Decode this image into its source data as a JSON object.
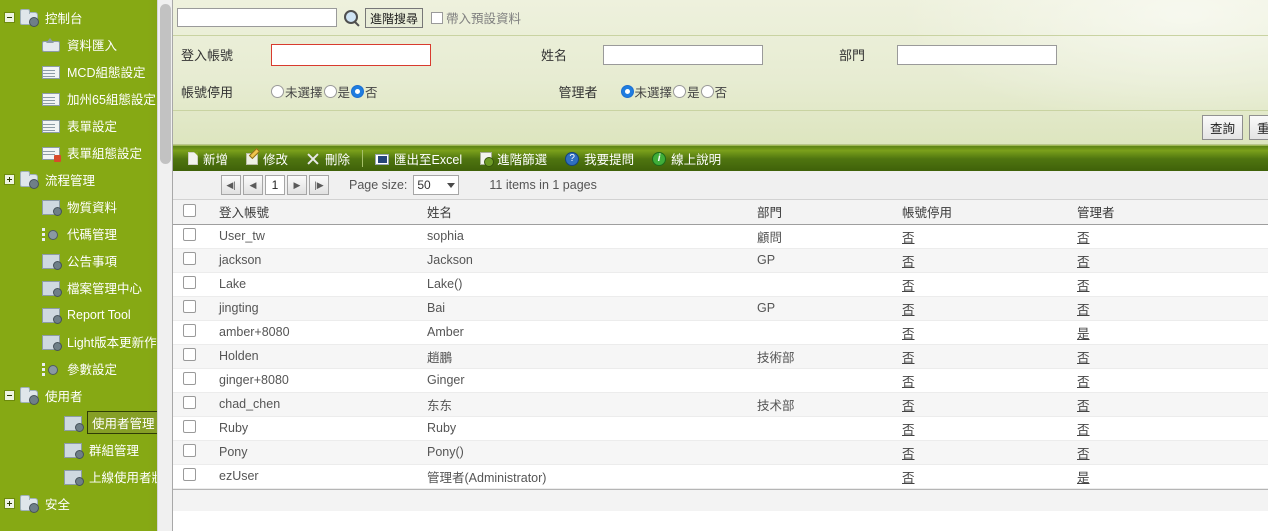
{
  "sidebar": {
    "items": [
      {
        "label": "控制台",
        "level": 0,
        "icon": "folder-icon",
        "expander": "minus",
        "selected": false
      },
      {
        "label": "資料匯入",
        "level": 1,
        "icon": "import-icon",
        "expander": "none",
        "selected": false
      },
      {
        "label": "MCD組態設定",
        "level": 1,
        "icon": "grid-icon",
        "expander": "none",
        "selected": false
      },
      {
        "label": "加州65組態設定",
        "level": 1,
        "icon": "grid-icon",
        "expander": "none",
        "selected": false
      },
      {
        "label": "表單設定",
        "level": 1,
        "icon": "grid-icon",
        "expander": "none",
        "selected": false
      },
      {
        "label": "表單組態設定",
        "level": 1,
        "icon": "grid-warning-icon",
        "expander": "none",
        "selected": false
      },
      {
        "label": "流程管理",
        "level": 0,
        "icon": "folder-icon",
        "expander": "plus",
        "selected": false
      },
      {
        "label": "物質資料",
        "level": 1,
        "icon": "page-icon",
        "expander": "none",
        "selected": false
      },
      {
        "label": "代碼管理",
        "level": 1,
        "icon": "dots-icon",
        "expander": "none",
        "selected": false
      },
      {
        "label": "公告事項",
        "level": 1,
        "icon": "page-icon",
        "expander": "none",
        "selected": false
      },
      {
        "label": "檔案管理中心",
        "level": 1,
        "icon": "page-icon",
        "expander": "none",
        "selected": false
      },
      {
        "label": "Report Tool",
        "level": 1,
        "icon": "page-icon",
        "expander": "none",
        "selected": false
      },
      {
        "label": "Light版本更新作業",
        "level": 1,
        "icon": "page-icon",
        "expander": "none",
        "selected": false
      },
      {
        "label": "參數設定",
        "level": 1,
        "icon": "dots-icon",
        "expander": "none",
        "selected": false
      },
      {
        "label": "使用者",
        "level": 0,
        "icon": "folder-icon",
        "expander": "minus",
        "selected": false
      },
      {
        "label": "使用者管理",
        "level": 2,
        "icon": "page-icon",
        "expander": "none",
        "selected": true
      },
      {
        "label": "群組管理",
        "level": 2,
        "icon": "page-icon",
        "expander": "none",
        "selected": false
      },
      {
        "label": "上線使用者狀態",
        "level": 2,
        "icon": "page-icon",
        "expander": "none",
        "selected": false
      },
      {
        "label": "安全",
        "level": 0,
        "icon": "folder-icon",
        "expander": "plus",
        "selected": false
      }
    ]
  },
  "search": {
    "quick_value": "",
    "search_icon": "magnifier-icon",
    "advanced_button": "進階搜尋",
    "default_data_checkbox_label": "帶入預設資料",
    "default_data_checked": false,
    "fields": {
      "login_account_label": "登入帳號",
      "login_account_value": "",
      "name_label": "姓名",
      "name_value": "",
      "dept_label": "部門",
      "dept_value": "",
      "account_disabled_label": "帳號停用",
      "account_disabled_options": [
        "未選擇",
        "是",
        "否"
      ],
      "account_disabled_selected": "否",
      "admin_label": "管理者",
      "admin_options": [
        "未選擇",
        "是",
        "否"
      ],
      "admin_selected": "未選擇"
    },
    "query_button": "查詢",
    "reset_button": "重設"
  },
  "toolbar": {
    "items": [
      {
        "label": "新增",
        "icon": "new-page-icon"
      },
      {
        "label": "修改",
        "icon": "edit-pencil-icon"
      },
      {
        "label": "刪除",
        "icon": "delete-x-icon"
      },
      {
        "label": "匯出至Excel",
        "icon": "excel-export-icon"
      },
      {
        "label": "進階篩選",
        "icon": "advanced-filter-icon"
      },
      {
        "label": "我要提問",
        "icon": "question-mark-icon",
        "glyph": "?"
      },
      {
        "label": "線上說明",
        "icon": "info-icon",
        "glyph": "i"
      }
    ]
  },
  "pager": {
    "first_icon": "first-page-icon",
    "prev_icon": "prev-page-icon",
    "next_icon": "next-page-icon",
    "last_icon": "last-page-icon",
    "current_page": "1",
    "page_size_label": "Page size:",
    "page_size_value": "50",
    "item_count_text": "11 items in 1 pages"
  },
  "grid": {
    "columns": [
      "登入帳號",
      "姓名",
      "部門",
      "帳號停用",
      "管理者"
    ],
    "select_all_checked": false,
    "rows": [
      {
        "account": "User_tw",
        "name": "sophia",
        "dept": "顧問",
        "disabled": "否",
        "admin": "否"
      },
      {
        "account": "jackson",
        "name": "Jackson",
        "dept": "GP",
        "disabled": "否",
        "admin": "否"
      },
      {
        "account": "Lake",
        "name": "Lake()",
        "dept": "",
        "disabled": "否",
        "admin": "否"
      },
      {
        "account": "jingting",
        "name": "Bai",
        "dept": "GP",
        "disabled": "否",
        "admin": "否"
      },
      {
        "account": "amber+8080",
        "name": "Amber",
        "dept": "",
        "disabled": "否",
        "admin": "是"
      },
      {
        "account": "Holden",
        "name": "趙鵬",
        "dept": "技術部",
        "disabled": "否",
        "admin": "否"
      },
      {
        "account": "ginger+8080",
        "name": "Ginger",
        "dept": "",
        "disabled": "否",
        "admin": "否"
      },
      {
        "account": "chad_chen",
        "name": "东东",
        "dept": "技术部",
        "disabled": "否",
        "admin": "否"
      },
      {
        "account": "Ruby",
        "name": "Ruby",
        "dept": "",
        "disabled": "否",
        "admin": "否"
      },
      {
        "account": "Pony",
        "name": "Pony()",
        "dept": "",
        "disabled": "否",
        "admin": "否"
      },
      {
        "account": "ezUser",
        "name": "管理者(Administrator)",
        "dept": "",
        "disabled": "否",
        "admin": "是"
      }
    ]
  },
  "colors": {
    "sidebar_green": "#86a914",
    "toolbar_green": "#4f7510",
    "panel_bg": "#e7ecd2",
    "focus_red": "#d83b2e",
    "radio_blue": "#1f7de0"
  }
}
